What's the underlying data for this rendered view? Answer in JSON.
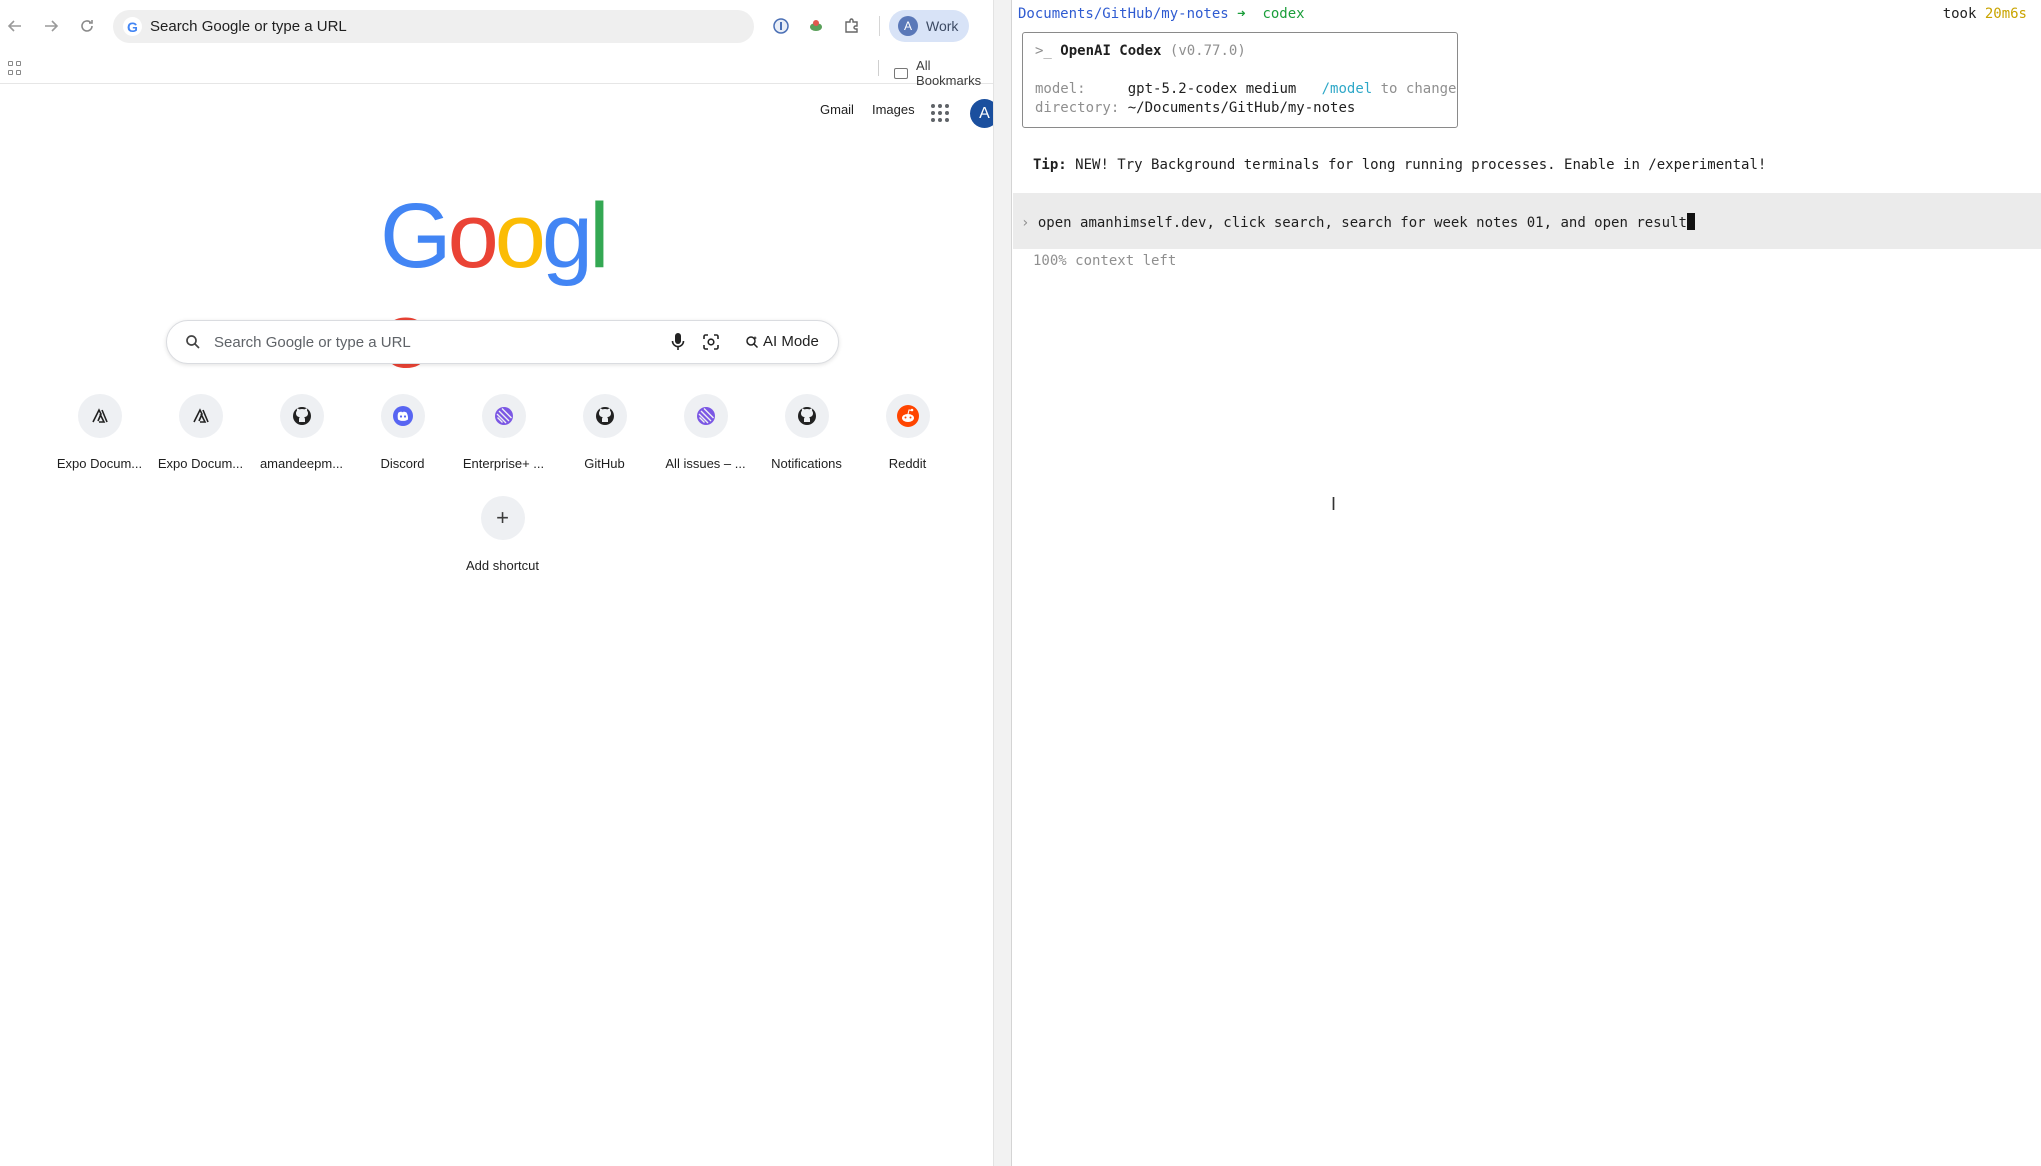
{
  "browser": {
    "omnibox_placeholder": "Search Google or type a URL",
    "profile_label": "Work",
    "profile_initial": "A",
    "all_bookmarks": "All Bookmarks",
    "ntp": {
      "links": [
        "Gmail",
        "Images"
      ],
      "avatar_initial": "A",
      "logo_letters": [
        "G",
        "o",
        "o",
        "g",
        "l",
        "e"
      ],
      "logo_colors": [
        "#4285f4",
        "#ea4335",
        "#fbbc05",
        "#4285f4",
        "#34a853",
        "#ea4335"
      ],
      "search_placeholder": "Search Google or type a URL",
      "ai_mode_label": "AI Mode",
      "shortcuts": [
        {
          "label": "Expo Docum...",
          "icon": "expo-icon"
        },
        {
          "label": "Expo Docum...",
          "icon": "expo-icon"
        },
        {
          "label": "amandeepm...",
          "icon": "github-icon"
        },
        {
          "label": "Discord",
          "icon": "discord-icon"
        },
        {
          "label": "Enterprise+ ...",
          "icon": "linear-icon"
        },
        {
          "label": "GitHub",
          "icon": "github-icon"
        },
        {
          "label": "All issues – ...",
          "icon": "linear-icon"
        },
        {
          "label": "Notifications",
          "icon": "github-icon"
        },
        {
          "label": "Reddit",
          "icon": "reddit-icon"
        }
      ],
      "add_shortcut_label": "Add shortcut"
    }
  },
  "terminal": {
    "prompt_path": "Documents/GitHub/my-notes",
    "prompt_arrow": "➜",
    "prompt_command": "codex",
    "took_label": "took",
    "took_value": "20m6s",
    "banner": {
      "prefix": ">_",
      "title": "OpenAI Codex",
      "version": "(v0.77.0)",
      "model_key": "model:",
      "model_value": "gpt-5.2-codex medium",
      "model_cmd": "/model",
      "model_hint": "to change",
      "dir_key": "directory:",
      "dir_value": "~/Documents/GitHub/my-notes"
    },
    "tip_label": "Tip:",
    "tip_text": "NEW! Try Background terminals for long running processes. Enable in /experimental!",
    "input_marker": "›",
    "input_text": "open amanhimself.dev, click search, search for week notes 01, and open result",
    "context_left": "100% context left"
  },
  "colors": {
    "terminal_path": "#2f5bd1",
    "terminal_command": "#1a9e3a",
    "terminal_timing": "#c9a400",
    "profile_chip": "#d8e3f7"
  }
}
